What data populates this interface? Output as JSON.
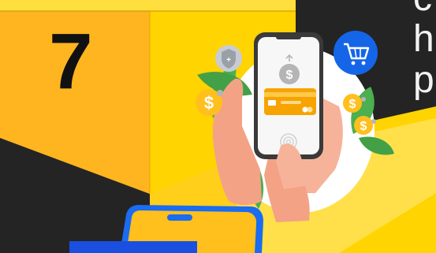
{
  "step": {
    "number": "7"
  },
  "side_text": {
    "line1": "c",
    "line2": "h",
    "line3": "p"
  },
  "icons": {
    "shield": "shield-icon",
    "cart": "shopping-cart-icon",
    "coin": "dollar-coin-icon",
    "phone": "smartphone-icon",
    "card": "credit-card-icon",
    "fingerprint": "fingerprint-icon",
    "upload": "arrow-up-icon"
  },
  "colors": {
    "background": "#242424",
    "cube_front": "#ffb51f",
    "cube_side": "#ffd400",
    "cube_top": "#ffdf3d",
    "floor": "#ffe04a",
    "cart_badge": "#1565e8",
    "leaf": "#4caf50",
    "card": "#f7a300",
    "coin": "#ffbf1c"
  }
}
